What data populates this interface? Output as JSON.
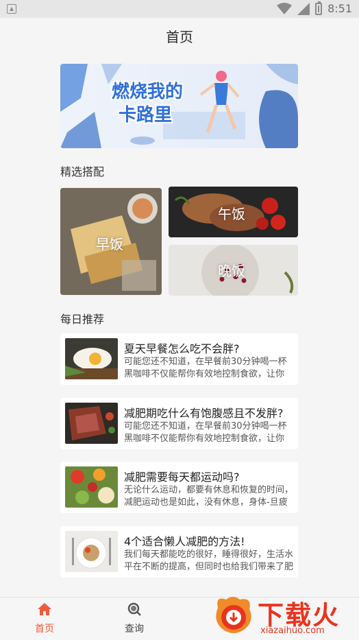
{
  "status_bar": {
    "time": "8:51"
  },
  "header": {
    "title": "首页"
  },
  "banner": {
    "line1": "燃烧我的",
    "line2": "卡路里"
  },
  "featured": {
    "title": "精选搭配",
    "breakfast": "早饭",
    "lunch": "午饭",
    "dinner": "晚饭"
  },
  "daily": {
    "title": "每日推荐",
    "items": [
      {
        "title": "夏天早餐怎么吃不会胖?",
        "desc": "可能您还不知道，在早餐前30分钟喝一杯黑咖啡不仅能帮你有效地控制食欲，让你只..."
      },
      {
        "title": "减肥期吃什么有饱腹感且不发胖?",
        "desc": "可能您还不知道，在早餐前30分钟喝一杯黑咖啡不仅能帮你有效地控制食欲，让你只..."
      },
      {
        "title": "减肥需要每天都运动吗?",
        "desc": "无论什么运动，都要有休息和恢复的时间，减肥运动也是如此，没有休息，身体-旦疲惫"
      },
      {
        "title": "4个适合懒人减肥的方法!",
        "desc": "我们每天都能吃的很好，睡得很好，生活水平在不断的提高，但同时也给我们带来了肥胖"
      }
    ]
  },
  "tabbar": {
    "home": "首页",
    "search": "查询"
  },
  "watermark": {
    "brand": "下载火",
    "domain": "xiazaihuo.com"
  },
  "colors": {
    "accent": "#ef5b3d",
    "banner_text": "#2f6fd9"
  }
}
